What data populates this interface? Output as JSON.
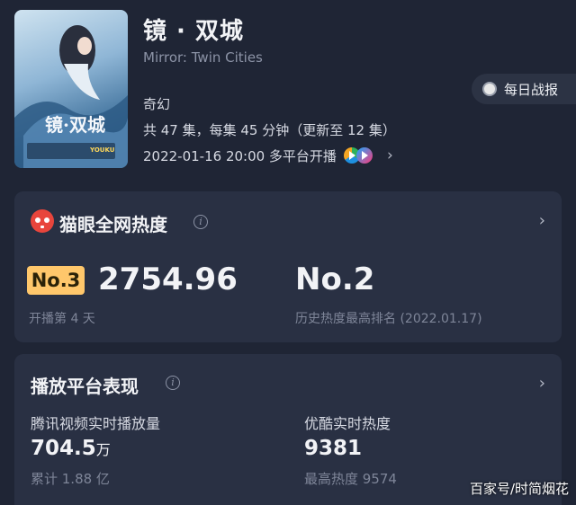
{
  "show": {
    "title": "镜 · 双城",
    "subtitle": "Mirror: Twin Cities",
    "genre": "奇幻",
    "episodes": "共 47 集，每集 45 分钟（更新至 12 集）",
    "premiere": "2022-01-16 20:00 多平台开播",
    "poster_title": "镜·双城",
    "poster_platforms": "YOUKU"
  },
  "daily_report": {
    "label": "每日战报"
  },
  "maoyan_heat": {
    "title": "猫眼全网热度",
    "rank": "No.3",
    "heat": "2754.96",
    "day": "开播第 4 天",
    "best_rank": "No.2",
    "best_rank_label": "历史热度最高排名 (2022.01.17)"
  },
  "platform": {
    "title": "播放平台表现",
    "tencent": {
      "label": "腾讯视频实时播放量",
      "value": "704.5",
      "unit": "万",
      "sub": "累计 1.88 亿"
    },
    "youku": {
      "label": "优酷实时热度",
      "value": "9381",
      "sub": "最高热度 9574"
    }
  },
  "watermark": "百家号/时简烟花",
  "colors": {
    "background": "#1f2535",
    "card": "#293043",
    "rank_badge": "#ffc76b",
    "maoyan_red": "#e8453c"
  }
}
